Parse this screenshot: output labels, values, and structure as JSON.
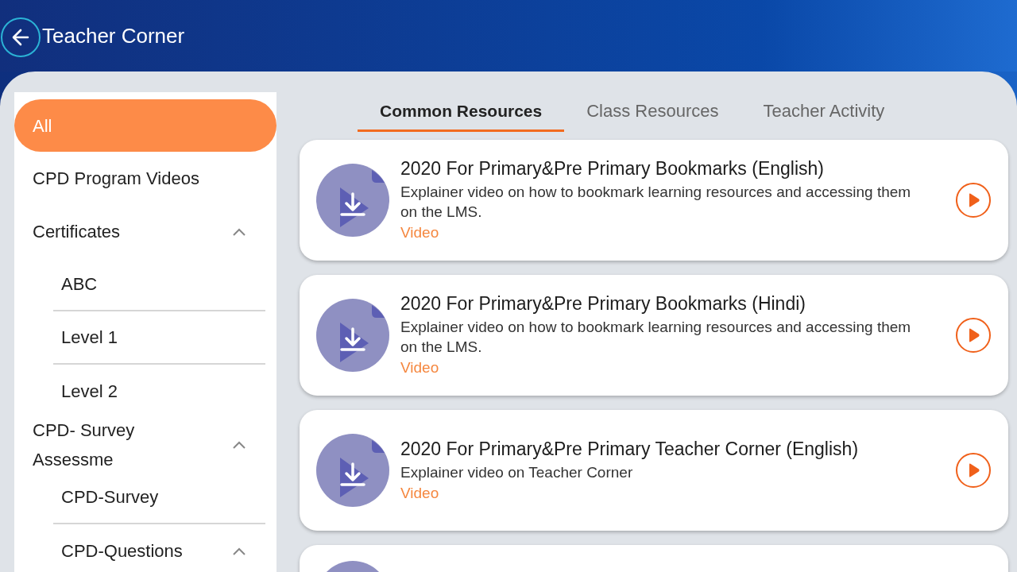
{
  "header": {
    "title": "Teacher Corner"
  },
  "sidebar": {
    "items": [
      {
        "label": "All",
        "selected": true
      },
      {
        "label": "CPD Program Videos",
        "selected": false
      },
      {
        "label": "Certificates",
        "selected": false,
        "expanded": true,
        "children": [
          {
            "label": "ABC",
            "selected": false
          },
          {
            "label": "Level 1",
            "selected": false
          },
          {
            "label": "Level 2",
            "selected": false
          }
        ]
      },
      {
        "label": "CPD- Survey Assessme",
        "selected": false,
        "expanded": true,
        "children": [
          {
            "label": "CPD-Survey",
            "selected": false
          },
          {
            "label": "CPD-Questions",
            "selected": false,
            "expanded": true
          }
        ]
      }
    ]
  },
  "tabs": [
    {
      "label": "Common Resources",
      "selected": true
    },
    {
      "label": "Class Resources",
      "selected": false
    },
    {
      "label": "Teacher Activity",
      "selected": false
    }
  ],
  "resources": [
    {
      "title": "2020 For Primary&Pre Primary Bookmarks (English)",
      "description": "Explainer video on how to bookmark learning resources and accessing them on the LMS.",
      "type": "Video"
    },
    {
      "title": "2020 For Primary&Pre Primary Bookmarks (Hindi)",
      "description": "Explainer video on how to bookmark learning resources and accessing them on the LMS.",
      "type": "Video"
    },
    {
      "title": "2020 For Primary&Pre Primary Teacher Corner (English)",
      "description": "Explainer video on Teacher Corner",
      "type": "Video"
    },
    {
      "kind": "partial"
    }
  ]
}
